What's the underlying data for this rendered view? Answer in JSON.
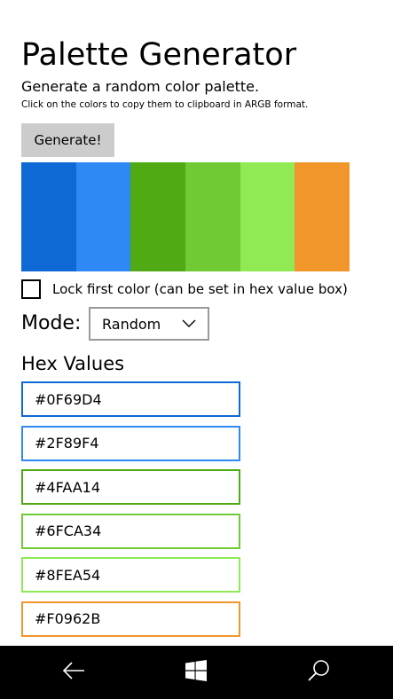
{
  "header": {
    "title": "Palette Generator",
    "subtitle": "Generate a random color palette.",
    "hint": "Click on the colors to copy them to clipboard in ARGB format."
  },
  "generate_button": {
    "label": "Generate!"
  },
  "palette": {
    "colors": [
      "#0F69D4",
      "#2F89F4",
      "#4FAA14",
      "#6FCA34",
      "#8FEA54",
      "#F0962B"
    ]
  },
  "lock": {
    "label": "Lock first color (can be set in hex value box)",
    "checked": false
  },
  "mode": {
    "label": "Mode:",
    "selected": "Random"
  },
  "hex_values": {
    "title": "Hex Values",
    "items": [
      "#0F69D4",
      "#2F89F4",
      "#4FAA14",
      "#6FCA34",
      "#8FEA54",
      "#F0962B"
    ]
  },
  "navbar": {
    "buttons": [
      "back-arrow-icon",
      "windows-start-icon",
      "search-icon"
    ],
    "background": "#000000"
  }
}
